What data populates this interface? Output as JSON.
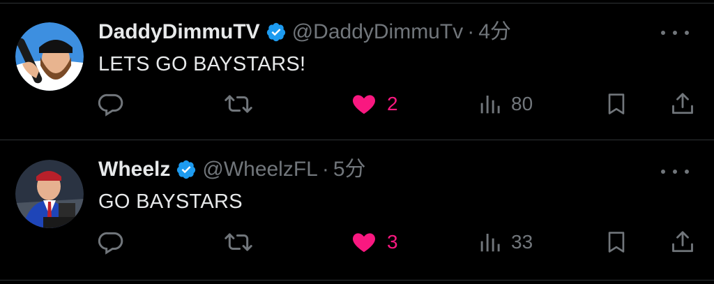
{
  "colors": {
    "background": "#000000",
    "primary_text": "#e7e9ea",
    "secondary_text": "#71767b",
    "like": "#f91880",
    "verified": "#1d9bf0",
    "divider": "#2f3336"
  },
  "tweets": [
    {
      "display_name": "DaddyDimmuTV",
      "handle": "@DaddyDimmuTv",
      "separator": "·",
      "time": "4分",
      "verified": true,
      "text": "LETS GO BAYSTARS!",
      "likes": "2",
      "liked": true,
      "views": "80",
      "icons": [
        "reply-icon",
        "retweet-icon",
        "heart-icon",
        "views-icon",
        "bookmark-icon",
        "share-icon",
        "more-icon"
      ]
    },
    {
      "display_name": "Wheelz",
      "handle": "@WheelzFL",
      "separator": "·",
      "time": "5分",
      "verified": true,
      "text": "GO BAYSTARS",
      "likes": "3",
      "liked": true,
      "views": "33",
      "icons": [
        "reply-icon",
        "retweet-icon",
        "heart-icon",
        "views-icon",
        "bookmark-icon",
        "share-icon",
        "more-icon"
      ]
    }
  ]
}
